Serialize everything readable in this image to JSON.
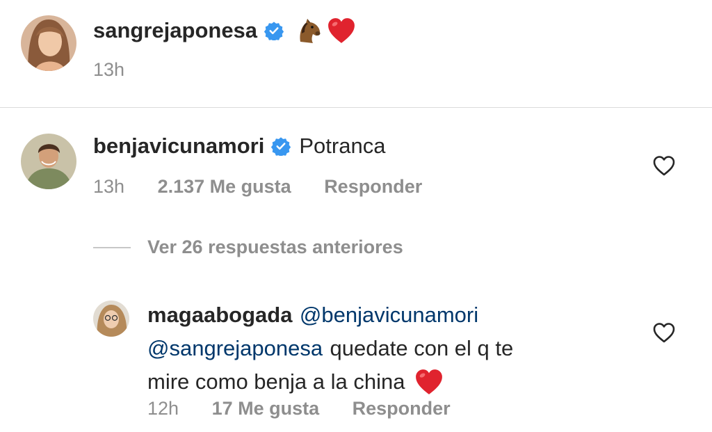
{
  "post": {
    "username": "sangrejaponesa",
    "caption_emojis": [
      "horse-face",
      "red-heart"
    ],
    "time": "13h"
  },
  "comment": {
    "username": "benjavicunamori",
    "text": "Potranca",
    "time": "13h",
    "likes": "2.137 Me gusta",
    "reply_label": "Responder"
  },
  "view_replies": {
    "label": "Ver 26 respuestas anteriores"
  },
  "reply": {
    "username": "magaabogada",
    "mention_1": "@benjavicunamori",
    "mention_2": "@sangrejaponesa",
    "text_1": "quedate con el q te",
    "text_2": "mire como benja a la china",
    "trailing_emoji": "red-heart",
    "time": "12h",
    "likes": "17 Me gusta",
    "reply_label": "Responder"
  },
  "colors": {
    "verified": "#3897f0",
    "heart": "#ed4956",
    "mention": "#00376b",
    "secondary_text": "#8e8e8e"
  }
}
